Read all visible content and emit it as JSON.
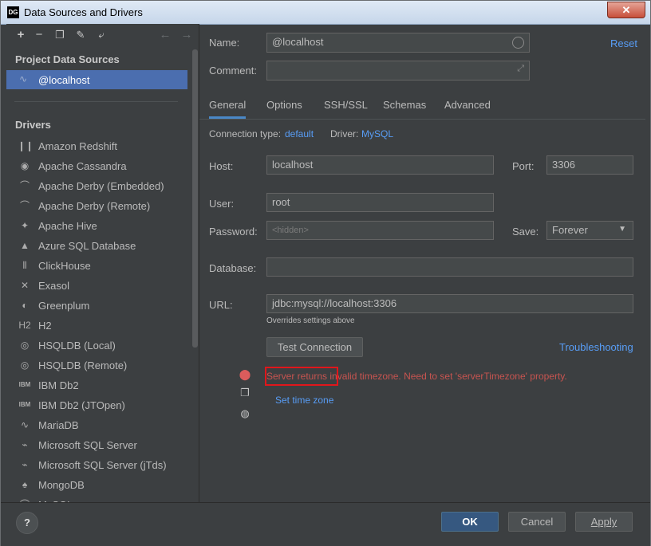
{
  "window": {
    "app_logo": "DG",
    "title": "Data Sources and Drivers",
    "close_symbol": "✕"
  },
  "toolbar": {
    "icons": [
      "add-icon",
      "remove-icon",
      "duplicate-icon",
      "wrench-icon",
      "import-icon",
      "back-arrow-icon",
      "forward-arrow-icon"
    ]
  },
  "left": {
    "project_sources_label": "Project Data Sources",
    "selected_source": "@localhost",
    "drivers_label": "Drivers",
    "drivers": [
      "Amazon Redshift",
      "Apache Cassandra",
      "Apache Derby (Embedded)",
      "Apache Derby (Remote)",
      "Apache Hive",
      "Azure SQL Database",
      "ClickHouse",
      "Exasol",
      "Greenplum",
      "H2",
      "HSQLDB (Local)",
      "HSQLDB (Remote)",
      "IBM Db2",
      "IBM Db2 (JTOpen)",
      "MariaDB",
      "Microsoft SQL Server",
      "Microsoft SQL Server (jTds)",
      "MongoDB",
      "MySQL"
    ],
    "driver_icons": [
      "❙❙",
      "◉",
      "⌒",
      "⌒",
      "✦",
      "▲",
      "⦀",
      "✕",
      "◐",
      "H2",
      "◎",
      "◎",
      "IBM",
      "IBM",
      "∿",
      "⌁",
      "⌁",
      "♠",
      "⌒"
    ]
  },
  "form": {
    "name_label": "Name:",
    "name_value": "@localhost",
    "reset_link": "Reset",
    "comment_label": "Comment:",
    "comment_value": "",
    "tabs": [
      "General",
      "Options",
      "SSH/SSL",
      "Schemas",
      "Advanced"
    ],
    "active_tab": "General",
    "connection_type_label": "Connection type:",
    "connection_type_value": "default",
    "driver_label": "Driver:",
    "driver_value": "MySQL",
    "host_label": "Host:",
    "host_value": "localhost",
    "port_label": "Port:",
    "port_value": "3306",
    "user_label": "User:",
    "user_value": "root",
    "password_label": "Password:",
    "password_placeholder": "<hidden>",
    "save_label": "Save:",
    "save_value": "Forever",
    "database_label": "Database:",
    "database_value": "",
    "url_label": "URL:",
    "url_value": "jdbc:mysql://localhost:3306",
    "url_hint": "Overrides settings above",
    "test_connection_button": "Test Connection",
    "troubleshooting_link": "Troubleshooting",
    "error_message": "Server returns invalid timezone. Need to set 'serverTimezone' property.",
    "set_timezone_link": "Set time zone"
  },
  "footer": {
    "help": "?",
    "ok": "OK",
    "cancel": "Cancel",
    "apply": "Apply"
  },
  "colors": {
    "accent": "#4b6eaf",
    "link": "#589df6",
    "error": "#c75450",
    "highlight": "#e0161b"
  }
}
